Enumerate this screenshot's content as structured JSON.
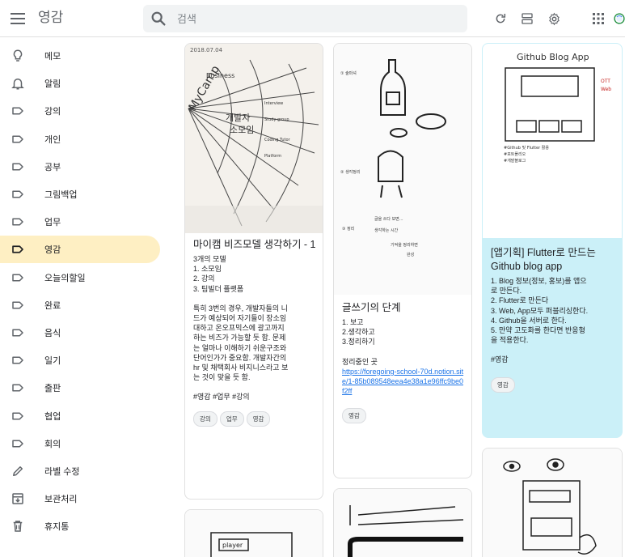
{
  "header": {
    "title": "영감",
    "search_placeholder": "검색",
    "icons": [
      "menu-icon",
      "search-icon",
      "refresh-icon",
      "list-view-icon",
      "settings-icon",
      "apps-icon",
      "account-icon"
    ]
  },
  "colors": {
    "active_nav": "#feefc3",
    "blue_note": "#cbf0f8",
    "link": "#1a73e8"
  },
  "sidebar": {
    "items": [
      {
        "label": "메모",
        "icon": "lightbulb-icon"
      },
      {
        "label": "알림",
        "icon": "bell-icon"
      },
      {
        "label": "강의",
        "icon": "label-icon"
      },
      {
        "label": "개인",
        "icon": "label-icon"
      },
      {
        "label": "공부",
        "icon": "label-icon"
      },
      {
        "label": "그림백업",
        "icon": "label-icon"
      },
      {
        "label": "업무",
        "icon": "label-icon"
      },
      {
        "label": "영감",
        "icon": "label-icon",
        "active": true
      },
      {
        "label": "오늘의할일",
        "icon": "label-icon"
      },
      {
        "label": "완료",
        "icon": "label-icon"
      },
      {
        "label": "음식",
        "icon": "label-icon"
      },
      {
        "label": "일기",
        "icon": "label-icon"
      },
      {
        "label": "출판",
        "icon": "label-icon"
      },
      {
        "label": "협업",
        "icon": "label-icon"
      },
      {
        "label": "회의",
        "icon": "label-icon"
      },
      {
        "label": "라벨 수정",
        "icon": "pencil-icon"
      },
      {
        "label": "보관처리",
        "icon": "archive-icon"
      },
      {
        "label": "휴지통",
        "icon": "trash-icon"
      }
    ]
  },
  "notes": {
    "note1": {
      "sketch_date": "2018.07.04",
      "title": "마이캠 비즈모델 생각하기 - 1",
      "lines": [
        "3개의 모델",
        "1. 소모임",
        "2. 강의",
        "3. 팀빌더 플랫폼",
        "",
        "특히 3번의 경우, 개발자들의 니",
        "드가 예상되어 자기들이 장소임",
        "대하고 온오프믹스에 광고까지",
        "하는 비즈가 가능할 듯 함. 문제",
        "는 얼마나 이해하기 쉬운구조와",
        "단어인가가 중요함. 개발자간의",
        "hr 및 채택회사 비지니스라고 보",
        "는 것이 맞을 듯 함.",
        "",
        "#영감 #업무 #강의"
      ],
      "chips": [
        "강의",
        "업무",
        "영감"
      ]
    },
    "note2": {
      "title": "글쓰기의 단계",
      "lines": [
        "1. 보고",
        "2.생각하고",
        "3.정리하기",
        "",
        "정리중인 곳"
      ],
      "link": "https://foregoing-school-70d.notion.site/1-85b089548eea4e38a1e96ffc9be0f2ff",
      "chips": [
        "영감"
      ]
    },
    "note3": {
      "sketch_title": "Github Blog App",
      "title": "[앱기획] Flutter로 만드는 Github blog app",
      "lines": [
        "1. Blog 정보(정보, 홍보)를 앱으",
        "로 만든다.",
        "2. Flutter로 만든다",
        "3. Web, App모두 퍼블리싱한다.",
        "4. Github을 서버로 한다.",
        "5. 만약 고도화를 한다면 반응형",
        "을 적용한다.",
        "",
        "#영감"
      ],
      "chips": [
        "영감"
      ]
    },
    "note4": {
      "sketch_label": "player"
    },
    "note5": {
      "sketch_text": ""
    },
    "note6": {
      "sketch_text": ""
    }
  }
}
